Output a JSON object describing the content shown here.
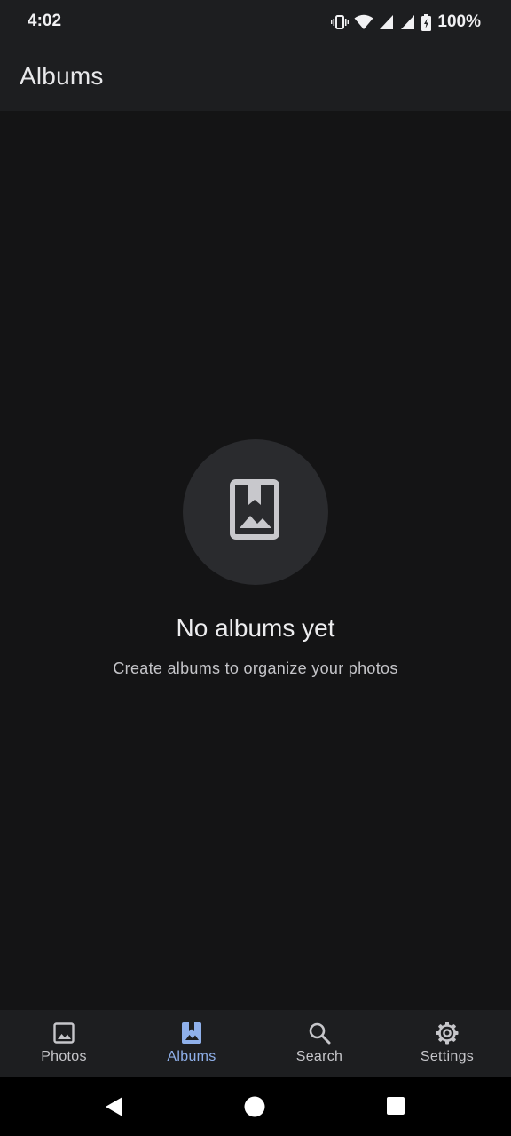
{
  "status_bar": {
    "time": "4:02",
    "battery": "100%",
    "icons": [
      "vibrate-icon",
      "wifi-icon",
      "signal-icon",
      "signal-icon",
      "battery-icon"
    ]
  },
  "app_bar": {
    "title": "Albums"
  },
  "empty_state": {
    "icon": "album-bookmark-icon",
    "title": "No albums yet",
    "subtitle": "Create albums to organize your photos"
  },
  "bottom_nav": {
    "items": [
      {
        "label": "Photos",
        "icon": "photo-icon",
        "active": false
      },
      {
        "label": "Albums",
        "icon": "album-icon",
        "active": true
      },
      {
        "label": "Search",
        "icon": "search-icon",
        "active": false
      },
      {
        "label": "Settings",
        "icon": "gear-icon",
        "active": false
      }
    ]
  },
  "system_nav": {
    "buttons": [
      "back",
      "home",
      "recents"
    ]
  },
  "colors": {
    "background": "#141415",
    "bar": "#1d1e20",
    "accent": "#8fb0ea",
    "circle": "#2a2b2e"
  }
}
